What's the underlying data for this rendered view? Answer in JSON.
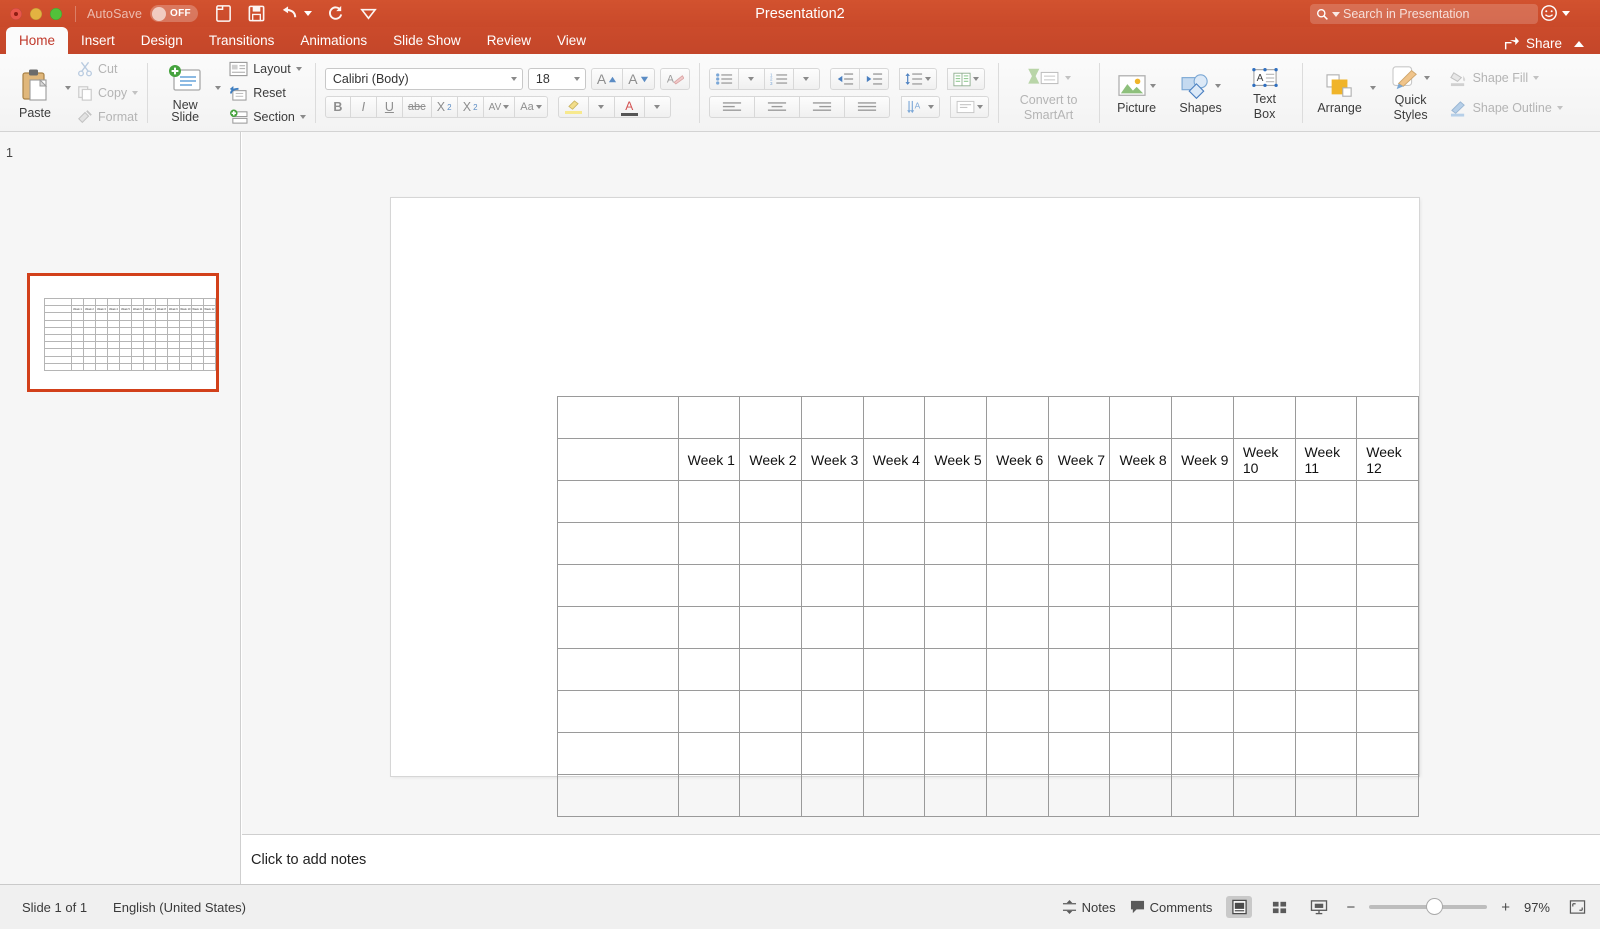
{
  "window": {
    "title": "Presentation2",
    "autosave_label": "AutoSave",
    "autosave_state": "OFF"
  },
  "search": {
    "placeholder": "Search in Presentation"
  },
  "share": {
    "label": "Share"
  },
  "tabs": [
    {
      "label": "Home",
      "active": true
    },
    {
      "label": "Insert",
      "active": false
    },
    {
      "label": "Design",
      "active": false
    },
    {
      "label": "Transitions",
      "active": false
    },
    {
      "label": "Animations",
      "active": false
    },
    {
      "label": "Slide Show",
      "active": false
    },
    {
      "label": "Review",
      "active": false
    },
    {
      "label": "View",
      "active": false
    }
  ],
  "ribbon": {
    "clipboard": {
      "paste": "Paste",
      "cut": "Cut",
      "copy": "Copy",
      "format": "Format"
    },
    "slides": {
      "new_slide": "New\nSlide",
      "new_slide_line1": "New",
      "new_slide_line2": "Slide",
      "layout": "Layout",
      "reset": "Reset",
      "section": "Section"
    },
    "font": {
      "name": "Calibri (Body)",
      "size": "18",
      "grow": "A",
      "shrink": "A",
      "clear_formatting": "A",
      "bold": "B",
      "italic": "I",
      "underline": "U",
      "strikethrough": "abc",
      "superscript": "X",
      "superscript_sup": "2",
      "subscript": "X",
      "subscript_sub": "2",
      "character_spacing": "AV",
      "change_case": "Aa",
      "highlight": "",
      "font_color": "A"
    },
    "drawing": {
      "convert_to_smartart_line1": "Convert to",
      "convert_to_smartart_line2": "SmartArt",
      "picture": "Picture",
      "shapes": "Shapes",
      "textbox_line1": "Text",
      "textbox_line2": "Box",
      "arrange": "Arrange",
      "quick_styles_line1": "Quick",
      "quick_styles_line2": "Styles",
      "shape_fill": "Shape Fill",
      "shape_outline": "Shape Outline"
    }
  },
  "thumbnails": [
    {
      "number": "1",
      "selected": true
    }
  ],
  "notes": {
    "placeholder": "Click to add notes"
  },
  "status": {
    "slide_counter": "Slide 1 of 1",
    "language": "English (United States)",
    "notes_button": "Notes",
    "comments_button": "Comments",
    "zoom_percent": "97%",
    "zoom_minus": "−",
    "zoom_plus": "+"
  },
  "slide_table": {
    "columns": 13,
    "header_row_empty": true,
    "week_headers": [
      "",
      "Week 1",
      "Week 2",
      "Week 3",
      "Week 4",
      "Week 5",
      "Week 6",
      "Week 7",
      "Week 8",
      "Week 9",
      "Week 10",
      "Week 11",
      "Week 12"
    ],
    "body_rows": 8,
    "body_cell_value": ""
  },
  "colors": {
    "ribbon_red": "#c9492a",
    "active_tab_text": "#c0392b",
    "thumb_selection": "#d2401a",
    "table_border": "#9a9a9a"
  }
}
